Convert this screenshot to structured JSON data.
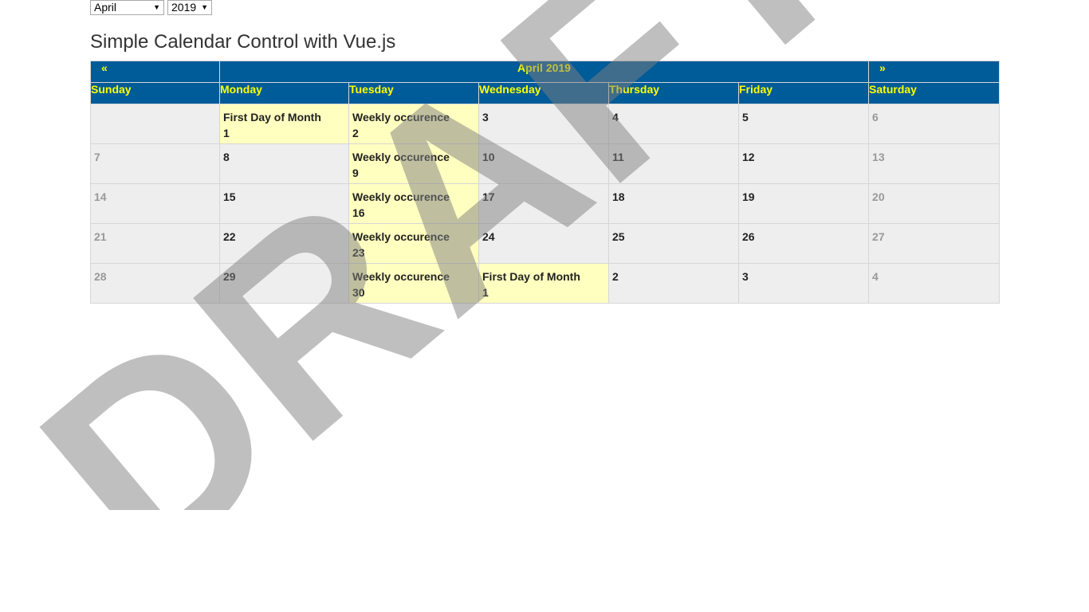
{
  "controls": {
    "month_value": "April",
    "year_value": "2019"
  },
  "page_title": "Simple Calendar Control with Vue.js",
  "calendar": {
    "prev_label": "«",
    "next_label": "»",
    "month_year": "April 2019",
    "weekdays": [
      "Sunday",
      "Monday",
      "Tuesday",
      "Wednesday",
      "Thursday",
      "Friday",
      "Saturday"
    ],
    "weeks": [
      [
        {
          "day": "",
          "event": "",
          "type": "blank"
        },
        {
          "day": "1",
          "event": "First Day of Month",
          "type": "event"
        },
        {
          "day": "2",
          "event": "Weekly occurence",
          "type": "event"
        },
        {
          "day": "3",
          "event": "",
          "type": "normal"
        },
        {
          "day": "4",
          "event": "",
          "type": "normal"
        },
        {
          "day": "5",
          "event": "",
          "type": "normal"
        },
        {
          "day": "6",
          "event": "",
          "type": "weekend"
        }
      ],
      [
        {
          "day": "7",
          "event": "",
          "type": "weekend"
        },
        {
          "day": "8",
          "event": "",
          "type": "normal"
        },
        {
          "day": "9",
          "event": "Weekly occurence",
          "type": "event"
        },
        {
          "day": "10",
          "event": "",
          "type": "normal"
        },
        {
          "day": "11",
          "event": "",
          "type": "normal"
        },
        {
          "day": "12",
          "event": "",
          "type": "normal"
        },
        {
          "day": "13",
          "event": "",
          "type": "weekend"
        }
      ],
      [
        {
          "day": "14",
          "event": "",
          "type": "weekend"
        },
        {
          "day": "15",
          "event": "",
          "type": "normal"
        },
        {
          "day": "16",
          "event": "Weekly occurence",
          "type": "event"
        },
        {
          "day": "17",
          "event": "",
          "type": "normal"
        },
        {
          "day": "18",
          "event": "",
          "type": "normal"
        },
        {
          "day": "19",
          "event": "",
          "type": "normal"
        },
        {
          "day": "20",
          "event": "",
          "type": "weekend"
        }
      ],
      [
        {
          "day": "21",
          "event": "",
          "type": "weekend"
        },
        {
          "day": "22",
          "event": "",
          "type": "normal"
        },
        {
          "day": "23",
          "event": "Weekly occurence",
          "type": "event"
        },
        {
          "day": "24",
          "event": "",
          "type": "normal"
        },
        {
          "day": "25",
          "event": "",
          "type": "normal"
        },
        {
          "day": "26",
          "event": "",
          "type": "normal"
        },
        {
          "day": "27",
          "event": "",
          "type": "weekend"
        }
      ],
      [
        {
          "day": "28",
          "event": "",
          "type": "weekend"
        },
        {
          "day": "29",
          "event": "",
          "type": "normal"
        },
        {
          "day": "30",
          "event": "Weekly occurence",
          "type": "event"
        },
        {
          "day": "1",
          "event": "First Day of Month",
          "type": "event"
        },
        {
          "day": "2",
          "event": "",
          "type": "normal"
        },
        {
          "day": "3",
          "event": "",
          "type": "normal"
        },
        {
          "day": "4",
          "event": "",
          "type": "weekend"
        }
      ]
    ]
  },
  "watermark": "DRAFT",
  "colors": {
    "header_bg": "#005b99",
    "header_text": "#ffff00",
    "cell_bg": "#eeeeee",
    "event_bg": "#ffffc0",
    "muted_text": "#999999"
  }
}
